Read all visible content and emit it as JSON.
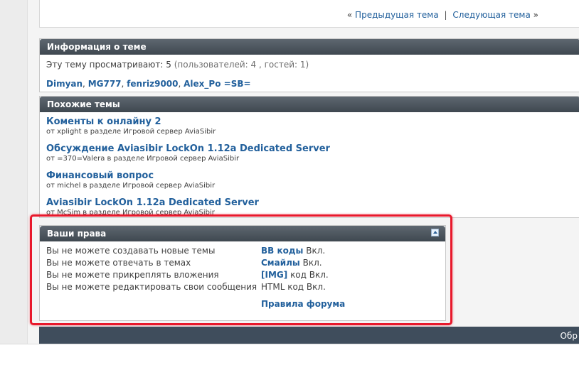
{
  "nav": {
    "prev_prefix": "«",
    "prev": "Предыдущая тема",
    "separator": "|",
    "next": "Следующая тема",
    "next_suffix": "»"
  },
  "info": {
    "title": "Информация о теме",
    "viewers_text": "Эту тему просматривают: 5",
    "viewers_detail": "(пользователей: 4 , гостей: 1)",
    "users": [
      "Dimyan",
      "MG777",
      "fenriz9000",
      "Alex_Po =SB="
    ]
  },
  "similar": {
    "title": "Похожие темы",
    "threads": [
      {
        "title": "Коменты к онлайну 2",
        "meta": "от xplight в разделе Игровой сервер AviaSibir"
      },
      {
        "title": "Обсуждение Aviasibir LockOn 1.12a Dedicated Server",
        "meta": "от =370=Valera в разделе Игровой сервер AviaSibir"
      },
      {
        "title": "Финансовый вопрос",
        "meta": "от michel в разделе Игровой сервер AviaSibir"
      },
      {
        "title": "Aviasibir LockOn 1.12a Dedicated Server",
        "meta": "от McSim в разделе Игровой сервер AviaSibir"
      }
    ]
  },
  "rights": {
    "title": "Ваши права",
    "left": [
      "Вы не можете создавать новые темы",
      "Вы не можете отвечать в темах",
      "Вы не можете прикреплять вложения",
      "Вы не можете редактировать свои сообщения"
    ],
    "right": [
      {
        "label": "BB коды",
        "status": "Вкл."
      },
      {
        "label": "Смайлы",
        "status": "Вкл."
      },
      {
        "label": "[IMG]",
        "status": "код Вкл."
      },
      {
        "label": "HTML код",
        "status": "Вкл."
      }
    ],
    "rules": "Правила форума"
  },
  "footer": {
    "text": "Обр"
  },
  "colors": {
    "link": "#22609c",
    "panel_header": "#4a535c",
    "highlight": "#e8192c",
    "footer_bar": "#3f4d5c"
  },
  "icons": {
    "collapse": "collapse-icon"
  }
}
